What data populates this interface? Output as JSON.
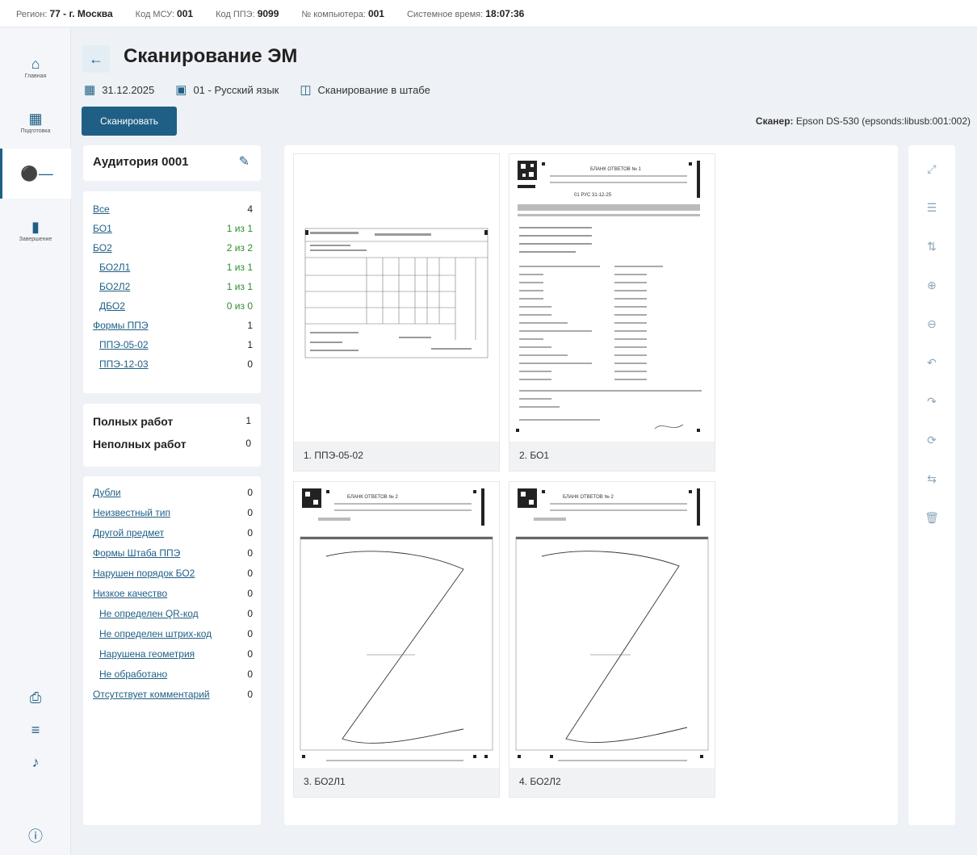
{
  "topbar": {
    "region_label": "Регион:",
    "region_value": "77 - г. Москва",
    "msu_label": "Код МСУ:",
    "msu_value": "001",
    "ppe_label": "Код ППЭ:",
    "ppe_value": "9099",
    "pc_label": "№ компьютера:",
    "pc_value": "001",
    "time_label": "Системное время:",
    "time_value": "18:07:36"
  },
  "nav": {
    "home": {
      "label": "Главная",
      "icon": "home-icon"
    },
    "prep": {
      "label": "Подготовка",
      "icon": "calendar-icon"
    },
    "key": {
      "label": "",
      "icon": "key-icon"
    },
    "finish": {
      "label": "Завершение",
      "icon": "document-icon"
    }
  },
  "header": {
    "title": "Сканирование ЭМ",
    "date": "31.12.2025",
    "subject": "01 - Русский язык",
    "mode": "Сканирование в штабе",
    "scan_button": "Сканировать",
    "scanner_label": "Сканер:",
    "scanner_value": "Epson DS-530 (epsonds:libusb:001:002)"
  },
  "auditory": {
    "title": "Аудитория 0001",
    "rows": [
      {
        "label": "Все",
        "value": "4"
      },
      {
        "label": "БО1",
        "value": "1 из 1"
      },
      {
        "label": "БО2",
        "value": "2 из 2"
      },
      {
        "label": "БО2Л1",
        "value": "1 из 1"
      },
      {
        "label": "БО2Л2",
        "value": "1 из 1"
      },
      {
        "label": "ДБО2",
        "value": "0 из 0"
      },
      {
        "label": "Формы ППЭ",
        "value": "1"
      },
      {
        "label": "ППЭ-05-02",
        "value": "1"
      },
      {
        "label": "ППЭ-12-03",
        "value": "0"
      }
    ]
  },
  "summary": {
    "full_label": "Полных работ",
    "full_value": "1",
    "partial_label": "Неполных работ",
    "partial_value": "0"
  },
  "problems": [
    {
      "label": "Дубли",
      "value": "0"
    },
    {
      "label": "Неизвестный тип",
      "value": "0"
    },
    {
      "label": "Другой предмет",
      "value": "0"
    },
    {
      "label": "Формы Штаба ППЭ",
      "value": "0"
    },
    {
      "label": "Нарушен порядок БО2",
      "value": "0"
    },
    {
      "label": "Низкое качество",
      "value": "0"
    },
    {
      "label": "Не определен QR-код",
      "value": "0"
    },
    {
      "label": "Не определен штрих-код",
      "value": "0"
    },
    {
      "label": "Нарушена геометрия",
      "value": "0"
    },
    {
      "label": "Не обработано",
      "value": "0"
    },
    {
      "label": "Отсутствует комментарий",
      "value": "0"
    }
  ],
  "cards": [
    {
      "caption": "1. ППЭ-05-02"
    },
    {
      "caption": "2. БО1"
    },
    {
      "caption": "3. БО2Л1"
    },
    {
      "caption": "4. БО2Л2"
    }
  ],
  "form_header": {
    "title": "БЛАНК ОТВЕТОВ № 1",
    "title2": "БЛАНК ОТВЕТОВ № 2",
    "code": "01 РУС 31-12-25"
  },
  "toolbar_icons": [
    "fullscreen-icon",
    "list-icon",
    "sort-icon",
    "zoom-in-icon",
    "zoom-out-icon",
    "rotate-left-icon",
    "rotate-right-icon",
    "reset-icon",
    "swap-icon",
    "delete-icon"
  ],
  "colors": {
    "accent": "#1f5f85",
    "green": "#2e8b2e"
  }
}
